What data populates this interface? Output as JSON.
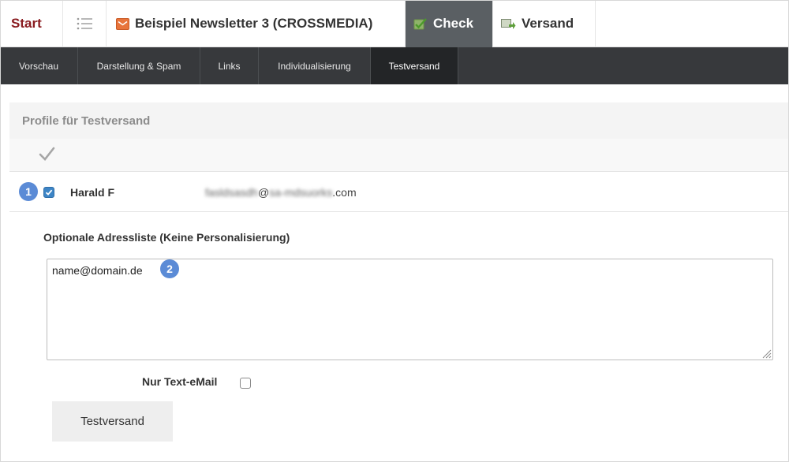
{
  "topbar": {
    "start_label": "Start",
    "newsletter_title": "Beispiel Newsletter 3 (CROSSMEDIA)",
    "check_label": "Check",
    "versand_label": "Versand"
  },
  "subnav": {
    "tabs": [
      {
        "label": "Vorschau"
      },
      {
        "label": "Darstellung & Spam"
      },
      {
        "label": "Links"
      },
      {
        "label": "Individualisierung"
      },
      {
        "label": "Testversand",
        "active": true
      }
    ]
  },
  "panel": {
    "title": "Profile für Testversand",
    "profile": {
      "badge": "1",
      "checked": true,
      "name": "Harald F",
      "email_blurred_part1": "fasldsasdh",
      "email_at": "@",
      "email_blurred_part2": "sa-mdsuorks",
      "email_suffix": ".com"
    },
    "address_list_label": "Optionale Adressliste (Keine Personalisierung)",
    "address_list_value": "name@domain.de",
    "address_badge": "2",
    "text_only_label": "Nur Text-eMail",
    "text_only_checked": false,
    "send_button_label": "Testversand"
  },
  "colors": {
    "accent_brand": "#8a1c20",
    "badge_blue": "#5b8bd6",
    "subnav_bg": "#37393c",
    "check_tab_bg": "#5a5f63"
  }
}
